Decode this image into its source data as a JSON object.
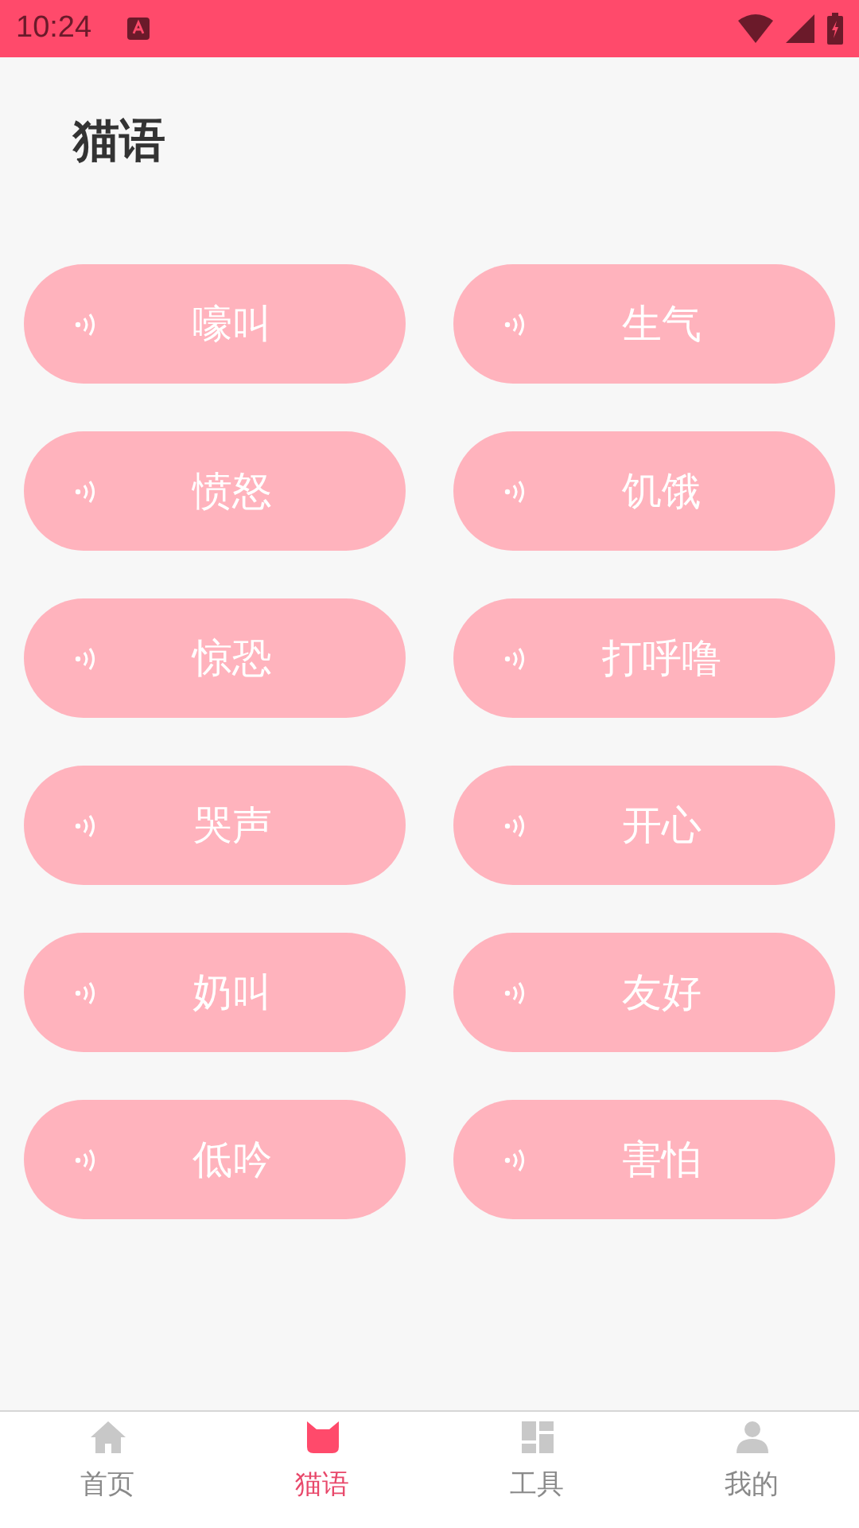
{
  "status_bar": {
    "time": "10:24"
  },
  "title": "猫语",
  "sounds": [
    {
      "label": "嚎叫"
    },
    {
      "label": "生气"
    },
    {
      "label": "愤怒"
    },
    {
      "label": "饥饿"
    },
    {
      "label": "惊恐"
    },
    {
      "label": "打呼噜"
    },
    {
      "label": "哭声"
    },
    {
      "label": "开心"
    },
    {
      "label": "奶叫"
    },
    {
      "label": "友好"
    },
    {
      "label": "低吟"
    },
    {
      "label": "害怕"
    }
  ],
  "tabs": [
    {
      "label": "首页",
      "kind": "home",
      "selected": false
    },
    {
      "label": "猫语",
      "kind": "cat",
      "selected": true
    },
    {
      "label": "工具",
      "kind": "grid",
      "selected": false
    },
    {
      "label": "我的",
      "kind": "person",
      "selected": false
    }
  ]
}
